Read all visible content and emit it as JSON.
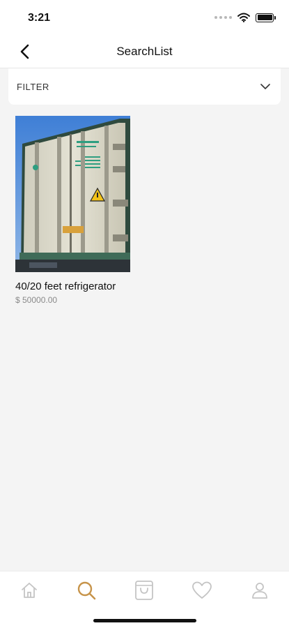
{
  "status_bar": {
    "time": "3:21",
    "icons": [
      "signal-dots-icon",
      "wifi-icon",
      "battery-icon"
    ]
  },
  "nav": {
    "title": "SearchList",
    "back_icon": "chevron-left-icon"
  },
  "filter": {
    "label": "FILTER",
    "chevron_icon": "chevron-down-icon"
  },
  "products": [
    {
      "name": "40/20 feet refrigerator",
      "price": "$ 50000.00",
      "image": "refrigerated-container-photo"
    }
  ],
  "tab_bar": {
    "items": [
      {
        "icon": "home-icon",
        "active": false
      },
      {
        "icon": "search-icon",
        "active": true
      },
      {
        "icon": "shopping-bag-icon",
        "active": false
      },
      {
        "icon": "heart-icon",
        "active": false
      },
      {
        "icon": "profile-icon",
        "active": false
      }
    ]
  },
  "colors": {
    "background": "#f4f4f4",
    "surface": "#ffffff",
    "active_tab": "#c7944a",
    "inactive_tab": "#c4c4c4",
    "price_text": "#8a8a8a"
  }
}
